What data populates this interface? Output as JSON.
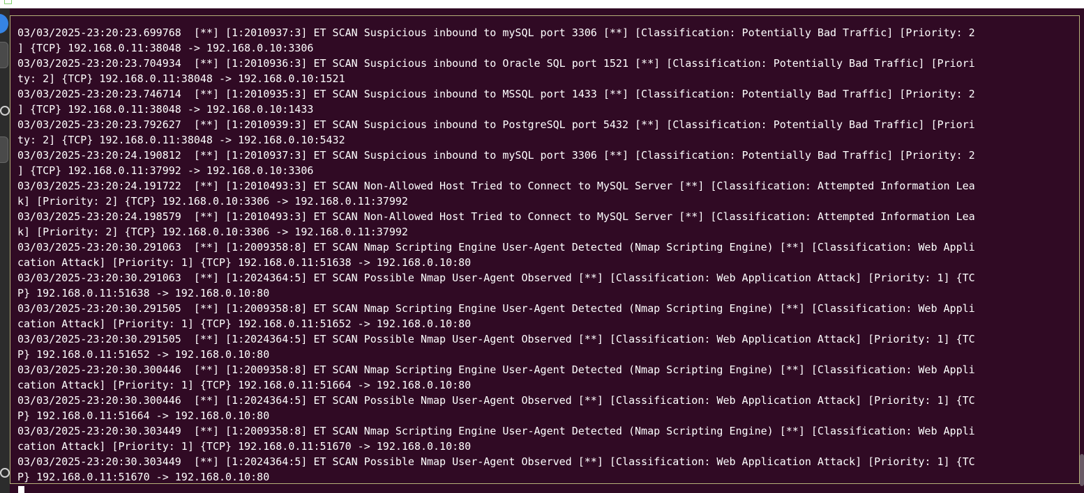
{
  "terminal": {
    "lines": [
      "03/03/2025-23:20:23.699768  [**] [1:2010937:3] ET SCAN Suspicious inbound to mySQL port 3306 [**] [Classification: Potentially Bad Traffic] [Priority: 2",
      "] {TCP} 192.168.0.11:38048 -> 192.168.0.10:3306",
      "03/03/2025-23:20:23.704934  [**] [1:2010936:3] ET SCAN Suspicious inbound to Oracle SQL port 1521 [**] [Classification: Potentially Bad Traffic] [Priori",
      "ty: 2] {TCP} 192.168.0.11:38048 -> 192.168.0.10:1521",
      "03/03/2025-23:20:23.746714  [**] [1:2010935:3] ET SCAN Suspicious inbound to MSSQL port 1433 [**] [Classification: Potentially Bad Traffic] [Priority: 2",
      "] {TCP} 192.168.0.11:38048 -> 192.168.0.10:1433",
      "03/03/2025-23:20:23.792627  [**] [1:2010939:3] ET SCAN Suspicious inbound to PostgreSQL port 5432 [**] [Classification: Potentially Bad Traffic] [Priori",
      "ty: 2] {TCP} 192.168.0.11:38048 -> 192.168.0.10:5432",
      "03/03/2025-23:20:24.190812  [**] [1:2010937:3] ET SCAN Suspicious inbound to mySQL port 3306 [**] [Classification: Potentially Bad Traffic] [Priority: 2",
      "] {TCP} 192.168.0.11:37992 -> 192.168.0.10:3306",
      "03/03/2025-23:20:24.191722  [**] [1:2010493:3] ET SCAN Non-Allowed Host Tried to Connect to MySQL Server [**] [Classification: Attempted Information Lea",
      "k] [Priority: 2] {TCP} 192.168.0.10:3306 -> 192.168.0.11:37992",
      "03/03/2025-23:20:24.198579  [**] [1:2010493:3] ET SCAN Non-Allowed Host Tried to Connect to MySQL Server [**] [Classification: Attempted Information Lea",
      "k] [Priority: 2] {TCP} 192.168.0.10:3306 -> 192.168.0.11:37992",
      "03/03/2025-23:20:30.291063  [**] [1:2009358:8] ET SCAN Nmap Scripting Engine User-Agent Detected (Nmap Scripting Engine) [**] [Classification: Web Appli",
      "cation Attack] [Priority: 1] {TCP} 192.168.0.11:51638 -> 192.168.0.10:80",
      "03/03/2025-23:20:30.291063  [**] [1:2024364:5] ET SCAN Possible Nmap User-Agent Observed [**] [Classification: Web Application Attack] [Priority: 1] {TC",
      "P} 192.168.0.11:51638 -> 192.168.0.10:80",
      "03/03/2025-23:20:30.291505  [**] [1:2009358:8] ET SCAN Nmap Scripting Engine User-Agent Detected (Nmap Scripting Engine) [**] [Classification: Web Appli",
      "cation Attack] [Priority: 1] {TCP} 192.168.0.11:51652 -> 192.168.0.10:80",
      "03/03/2025-23:20:30.291505  [**] [1:2024364:5] ET SCAN Possible Nmap User-Agent Observed [**] [Classification: Web Application Attack] [Priority: 1] {TC",
      "P} 192.168.0.11:51652 -> 192.168.0.10:80",
      "03/03/2025-23:20:30.300446  [**] [1:2009358:8] ET SCAN Nmap Scripting Engine User-Agent Detected (Nmap Scripting Engine) [**] [Classification: Web Appli",
      "cation Attack] [Priority: 1] {TCP} 192.168.0.11:51664 -> 192.168.0.10:80",
      "03/03/2025-23:20:30.300446  [**] [1:2024364:5] ET SCAN Possible Nmap User-Agent Observed [**] [Classification: Web Application Attack] [Priority: 1] {TC",
      "P} 192.168.0.11:51664 -> 192.168.0.10:80",
      "03/03/2025-23:20:30.303449  [**] [1:2009358:8] ET SCAN Nmap Scripting Engine User-Agent Detected (Nmap Scripting Engine) [**] [Classification: Web Appli",
      "cation Attack] [Priority: 1] {TCP} 192.168.0.11:51670 -> 192.168.0.10:80",
      "03/03/2025-23:20:30.303449  [**] [1:2024364:5] ET SCAN Possible Nmap User-Agent Observed [**] [Classification: Web Application Attack] [Priority: 1] {TC",
      "P} 192.168.0.11:51670 -> 192.168.0.10:80"
    ]
  },
  "dock": {
    "items": [
      {
        "icon": "app-launcher-icon"
      },
      {
        "icon": "terminal-app-icon"
      },
      {
        "icon": "network-icon"
      },
      {
        "icon": "files-app-icon"
      },
      {
        "icon": "settings-icon"
      }
    ]
  },
  "colors": {
    "terminal_bg": "#300a24",
    "terminal_fg": "#ffffff",
    "frame_border": "#b6b179",
    "accent": "#3584e4"
  }
}
